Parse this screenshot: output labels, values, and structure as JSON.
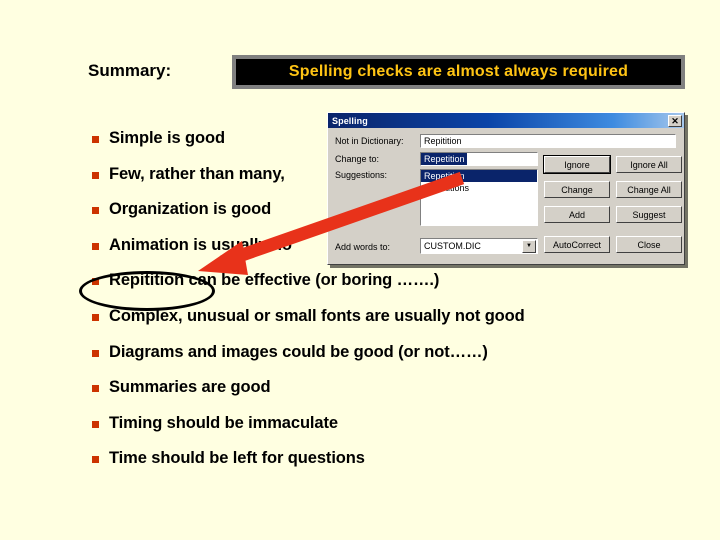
{
  "slide": {
    "background_color": "#FFFFE1",
    "summary_label": "Summary:",
    "banner": {
      "text": "Spelling checks are almost always required",
      "text_color": "#FFC414",
      "background_color": "#000000",
      "border_color": "#808080"
    },
    "bullets": [
      {
        "text": "Simple is good"
      },
      {
        "text": "Few, rather than many,"
      },
      {
        "text": "Organization is good"
      },
      {
        "text": "Animation is usually no"
      },
      {
        "text": "Repitition can be effective (or boring …….)"
      },
      {
        "text": "Complex, unusual or small fonts are usually not good"
      },
      {
        "text": "Diagrams and images could be good (or not……)"
      },
      {
        "text": "Summaries are good"
      },
      {
        "text": "Timing should be immaculate"
      },
      {
        "text": "Time should be left for questions"
      }
    ],
    "bullet_marker_color": "#CC3300",
    "annotations": {
      "ellipse_color": "#000000",
      "arrow_color": "#E8321A"
    }
  },
  "dialog": {
    "title": "Spelling",
    "close_label": "✕",
    "labels": {
      "not_in_dictionary": "Not in Dictionary:",
      "change_to": "Change to:",
      "suggestions": "Suggestions:",
      "add_words_to": "Add words to:"
    },
    "fields": {
      "not_in_dictionary_value": "Repitition",
      "change_to_value": "Repetition",
      "add_words_to_value": "CUSTOM.DIC",
      "dropdown_arrow": "▼"
    },
    "suggestions": [
      {
        "label": "Repetition",
        "selected": true
      },
      {
        "label": "Repetitions",
        "selected": false
      }
    ],
    "buttons": [
      {
        "label": "Ignore",
        "default": true
      },
      {
        "label": "Ignore All",
        "default": false
      },
      {
        "label": "Change",
        "default": false
      },
      {
        "label": "Change All",
        "default": false
      },
      {
        "label": "Add",
        "default": false
      },
      {
        "label": "Suggest",
        "default": false
      },
      {
        "label": "AutoCorrect",
        "default": false
      },
      {
        "label": "Close",
        "default": false
      }
    ]
  }
}
